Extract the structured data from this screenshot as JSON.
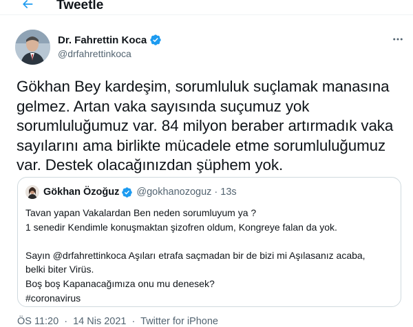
{
  "header": {
    "title": "Tweetle",
    "back_icon": "arrow-left-icon"
  },
  "author": {
    "name": "Dr. Fahrettin Koca",
    "handle": "@drfahrettinkoca",
    "verified": true,
    "more_icon": "more-horizontal-icon"
  },
  "tweet": {
    "text": "Gökhan Bey kardeşim, sorumluluk suçlamak manasına\ngelmez. Artan vaka sayısında suçumuz yok\nsorumluluğumuz var. 84 milyon beraber artırmadık vaka\nsayılarını ama birlikte mücadele etme sorumluluğumuz\nvar. Destek olacağınızdan şüphem yok."
  },
  "quote": {
    "name": "Gökhan Özoğuz",
    "verified": true,
    "handle": "@gokhanozoguz",
    "dot": "·",
    "time": "13s",
    "text": "Tavan yapan Vakalardan Ben neden sorumluyum ya ?\n1 senedir Kendimle konuşmaktan şizofren oldum, Kongreye falan da yok.\n\nSayın @drfahrettinkoca Aşıları etrafa saçmadan bir de bizi mi Aşılasanız acaba,\nbelki biter Virüs.\nBoş boş Kapanacağımıza onu mu denesek?\n#coronavirus"
  },
  "meta": {
    "time": "ÖS 11:20",
    "date": "14 Nis 2021",
    "source": "Twitter for iPhone",
    "separator": "·"
  },
  "colors": {
    "accent": "#1d9bf0",
    "text": "#0f1419",
    "secondary": "#536471",
    "border": "#cfd9de"
  }
}
